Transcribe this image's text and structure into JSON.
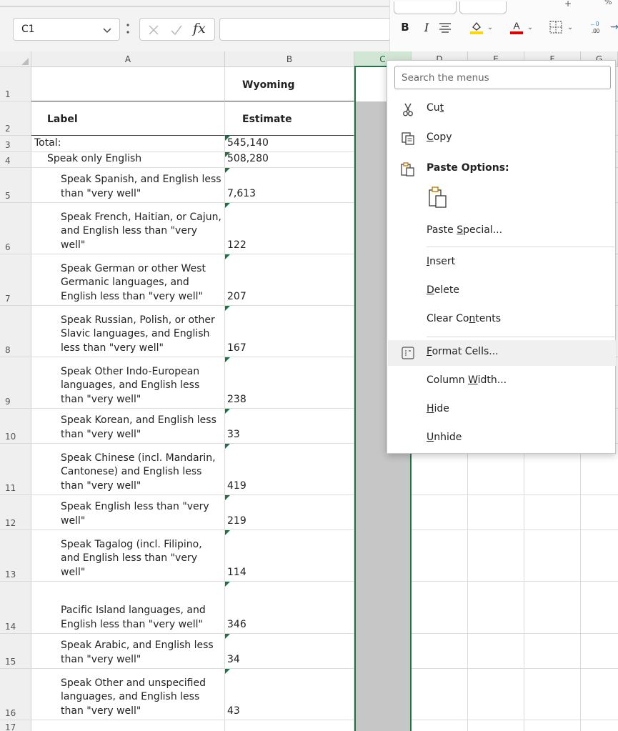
{
  "name_box": {
    "value": "C1"
  },
  "formula_bar": {
    "fx_label": "fx",
    "value": ""
  },
  "mini_toolbar": {
    "bold_label": "B",
    "italic_label": "I",
    "fill_color": "#ffd700",
    "font_color": "#e00000"
  },
  "columns": [
    "A",
    "B",
    "C",
    "D",
    "E",
    "F",
    "G"
  ],
  "selected_column": "C",
  "rows": [
    {
      "num": "1",
      "a": "",
      "b": "Wyoming",
      "a_indent": 0
    },
    {
      "num": "2",
      "a": "Label",
      "b": "Estimate",
      "a_indent": 0
    },
    {
      "num": "3",
      "a": "Total:",
      "b": "545,140",
      "a_indent": 0
    },
    {
      "num": "4",
      "a": "Speak only English",
      "b": "508,280",
      "a_indent": 1
    },
    {
      "num": "5",
      "a": "Speak Spanish, and English less than \"very well\"",
      "b": "7,613",
      "a_indent": 2
    },
    {
      "num": "6",
      "a": "Speak French, Haitian, or Cajun, and English less than \"very well\"",
      "b": "122",
      "a_indent": 2
    },
    {
      "num": "7",
      "a": "Speak German or other West Germanic languages, and English less than \"very well\"",
      "b": "207",
      "a_indent": 2
    },
    {
      "num": "8",
      "a": "Speak Russian, Polish, or other Slavic languages, and English less than \"very well\"",
      "b": "167",
      "a_indent": 2
    },
    {
      "num": "9",
      "a": "Speak Other Indo-European languages, and English less than \"very well\"",
      "b": "238",
      "a_indent": 2
    },
    {
      "num": "10",
      "a": "Speak Korean, and English less than \"very well\"",
      "b": "33",
      "a_indent": 2
    },
    {
      "num": "11",
      "a": "Speak Chinese (incl. Mandarin, Cantonese) and English less than \"very well\"",
      "b": "419",
      "a_indent": 2
    },
    {
      "num": "12",
      "a": "Speak English less than \"very well\"",
      "b": "219",
      "a_indent": 2
    },
    {
      "num": "13",
      "a": "Speak Tagalog (incl. Filipino, and English less than \"very well\"",
      "b": "114",
      "a_indent": 2
    },
    {
      "num": "14",
      "a": "Pacific Island languages, and English less than \"very well\"",
      "b": "346",
      "a_indent": 2
    },
    {
      "num": "15",
      "a": "Speak Arabic, and English less than \"very well\"",
      "b": "34",
      "a_indent": 2
    },
    {
      "num": "16",
      "a": "Speak Other and unspecified languages, and English less than \"very well\"",
      "b": "43",
      "a_indent": 2
    },
    {
      "num": "17",
      "a": "",
      "b": "",
      "a_indent": 0
    }
  ],
  "context_menu": {
    "search_placeholder": "Search the menus",
    "items": {
      "cut": {
        "pre": "Cu",
        "key": "t",
        "post": "",
        "icon": "scissors-icon"
      },
      "copy": {
        "pre": "",
        "key": "C",
        "post": "opy",
        "icon": "copy-icon"
      },
      "paste_options": {
        "label": "Paste Options:",
        "icon": "clipboard-icon"
      },
      "paste_special": {
        "pre": "Paste ",
        "key": "S",
        "post": "pecial...",
        "icon": ""
      },
      "insert": {
        "pre": "",
        "key": "I",
        "post": "nsert"
      },
      "delete": {
        "pre": "",
        "key": "D",
        "post": "elete"
      },
      "clear_contents": {
        "pre": "Clear Co",
        "key": "n",
        "post": "tents"
      },
      "format_cells": {
        "pre": "",
        "key": "F",
        "post": "ormat Cells...",
        "icon": "format-cells-icon"
      },
      "column_width": {
        "pre": "Column ",
        "key": "W",
        "post": "idth..."
      },
      "hide": {
        "pre": "",
        "key": "H",
        "post": "ide"
      },
      "unhide": {
        "pre": "",
        "key": "U",
        "post": "nhide"
      }
    }
  },
  "colors": {
    "selection_green": "#217346",
    "selected_column_fill": "#c6c6c6",
    "header_bg": "#efefef"
  }
}
